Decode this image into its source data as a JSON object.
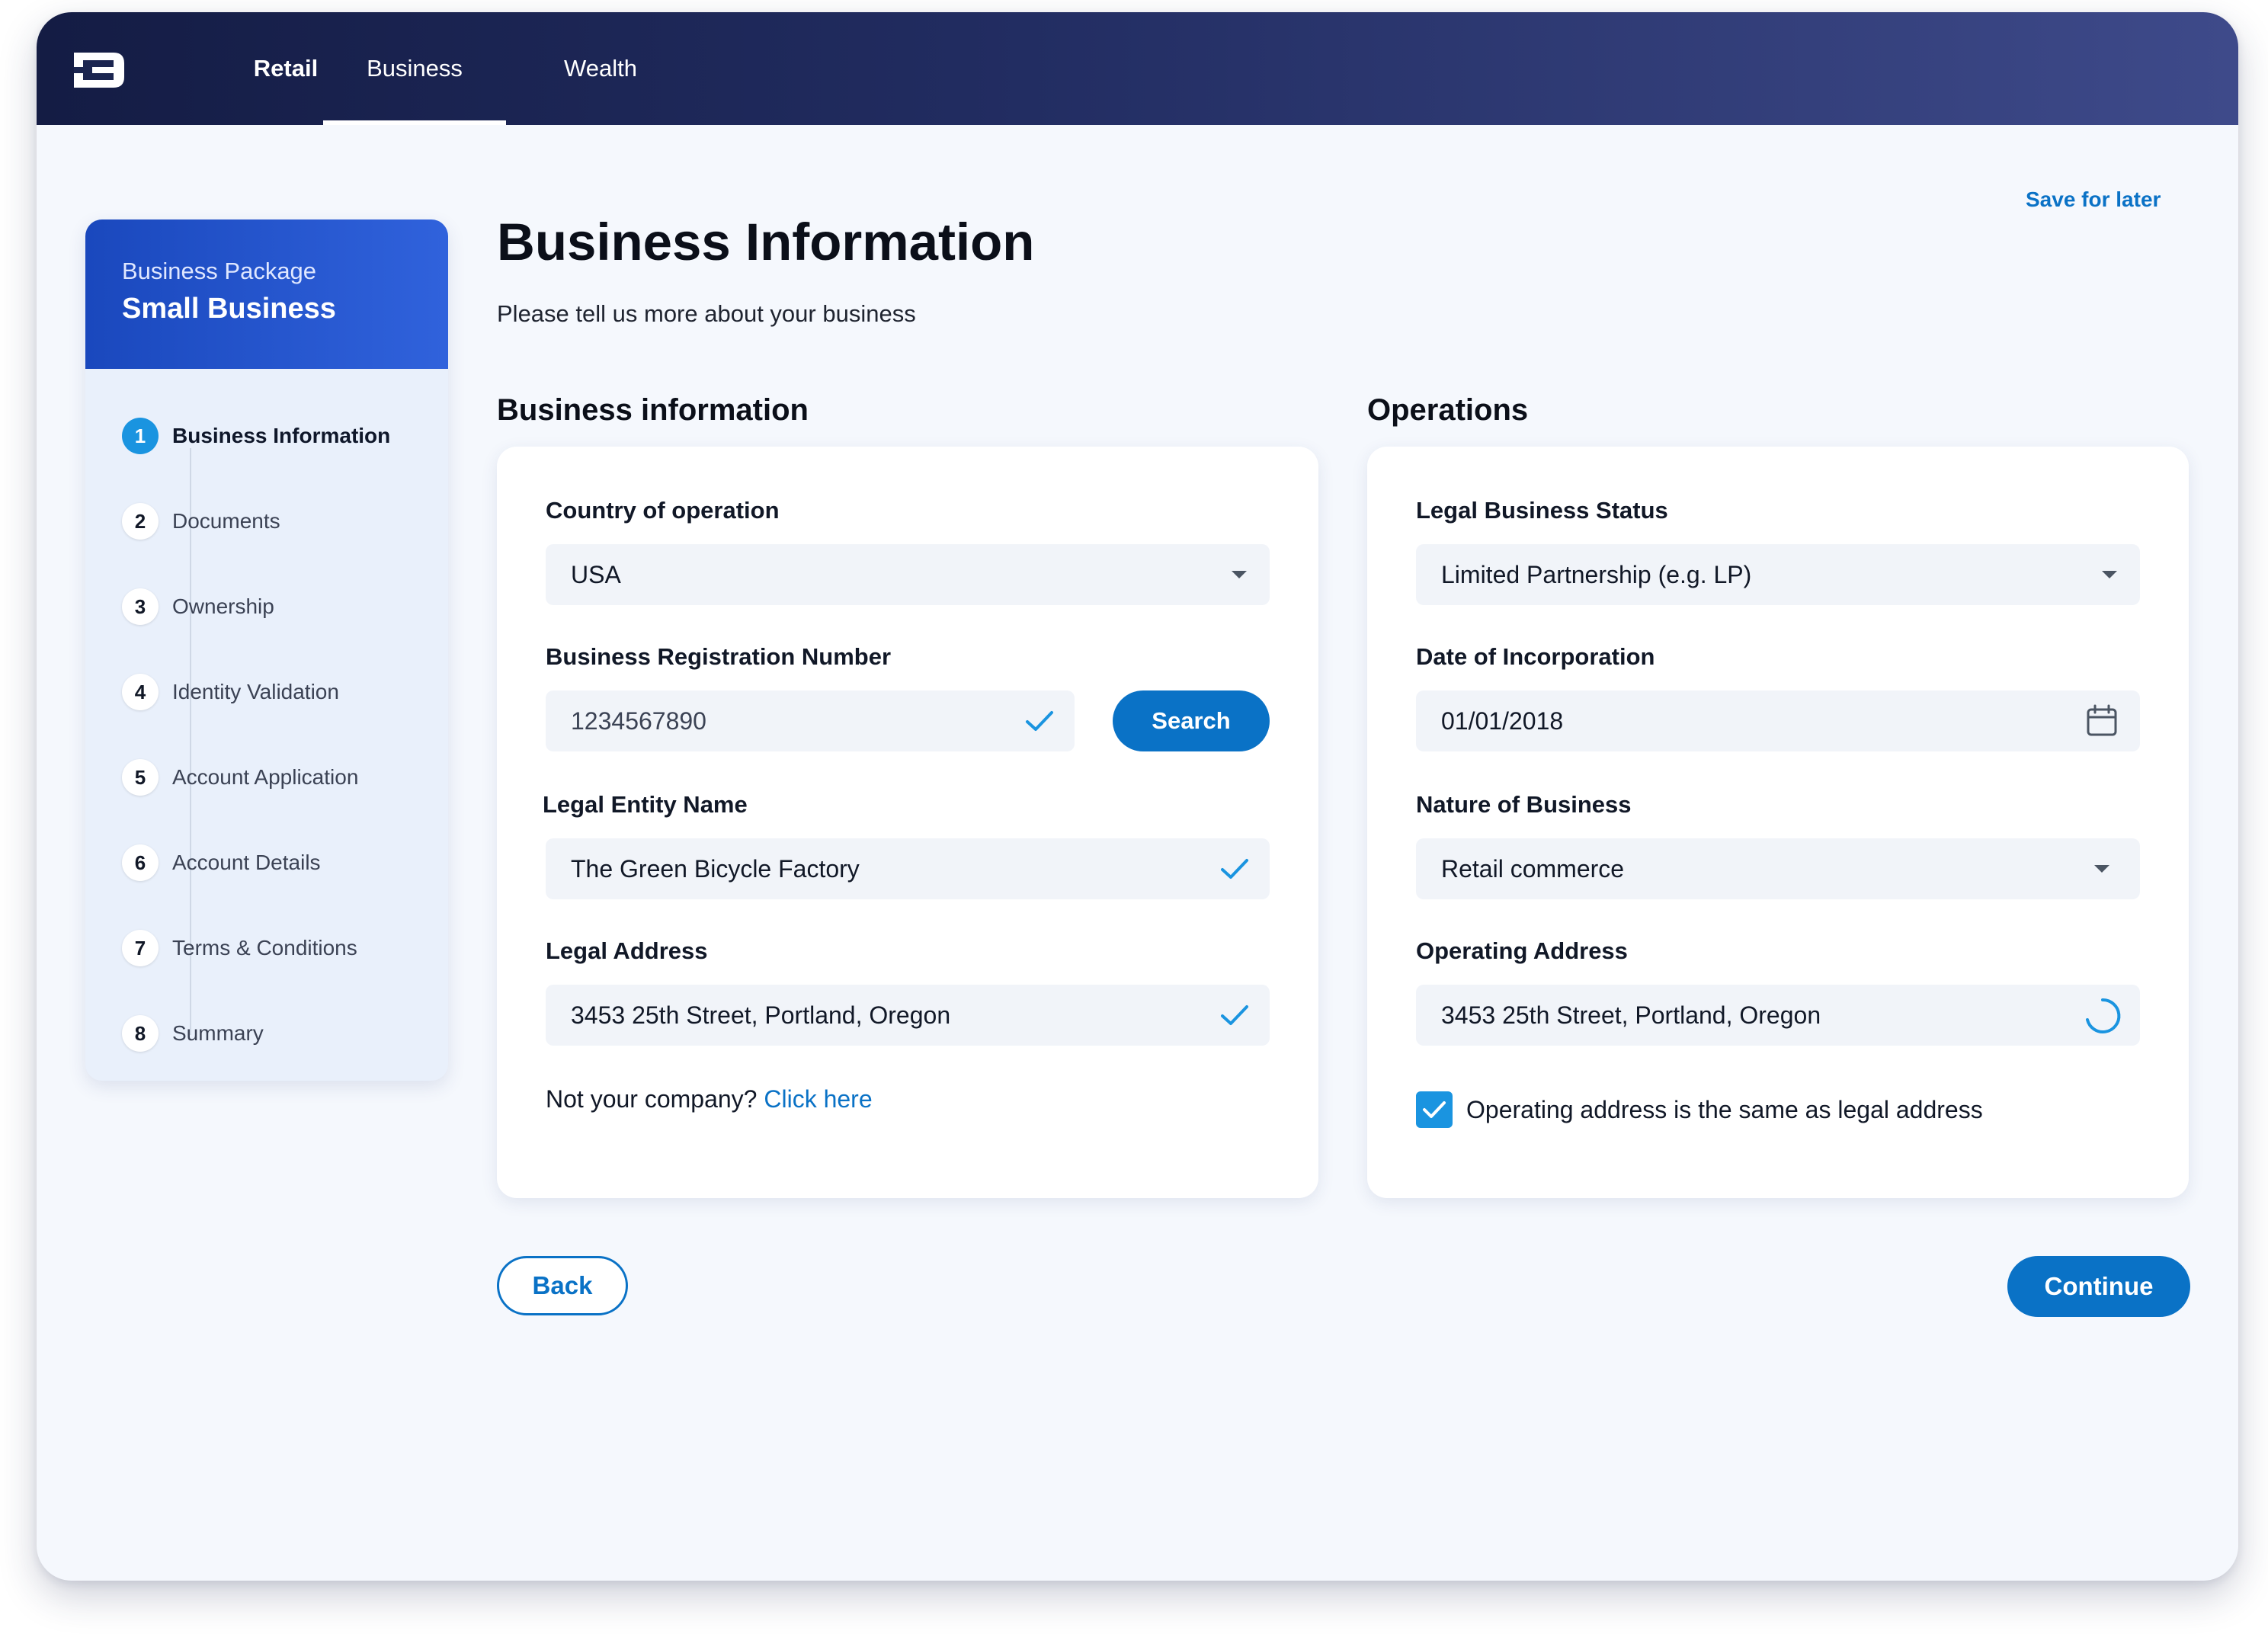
{
  "nav": {
    "tabs": [
      {
        "label": "Retail"
      },
      {
        "label": "Business"
      },
      {
        "label": "Wealth"
      }
    ]
  },
  "header": {
    "save_for_later": "Save for later"
  },
  "sidebar": {
    "package_label": "Business Package",
    "package_name": "Small Business",
    "steps": [
      {
        "num": "1",
        "label": "Business Information"
      },
      {
        "num": "2",
        "label": "Documents"
      },
      {
        "num": "3",
        "label": "Ownership"
      },
      {
        "num": "4",
        "label": "Identity Validation"
      },
      {
        "num": "5",
        "label": "Account Application"
      },
      {
        "num": "6",
        "label": "Account Details"
      },
      {
        "num": "7",
        "label": "Terms & Conditions"
      },
      {
        "num": "8",
        "label": "Summary"
      }
    ]
  },
  "main": {
    "title": "Business Information",
    "subtitle": "Please tell us more about your business"
  },
  "business_info": {
    "section_title": "Business information",
    "country_label": "Country of operation",
    "country_value": "USA",
    "reg_label": "Business Registration Number",
    "reg_value": "1234567890",
    "search_label": "Search",
    "entity_label": "Legal Entity Name",
    "entity_value": "The Green Bicycle Factory",
    "address_label": "Legal Address",
    "address_value": "3453 25th Street, Portland, Oregon",
    "not_company_text": "Not your company?",
    "click_here": "Click here"
  },
  "operations": {
    "section_title": "Operations",
    "status_label": "Legal Business Status",
    "status_value": "Limited Partnership (e.g. LP)",
    "date_label": "Date of Incorporation",
    "date_value": "01/01/2018",
    "nature_label": "Nature of Business",
    "nature_value": "Retail commerce",
    "op_address_label": "Operating Address",
    "op_address_value": "3453 25th Street, Portland, Oregon",
    "same_address_label": "Operating address is the same as legal address"
  },
  "footer": {
    "back_label": "Back",
    "continue_label": "Continue"
  },
  "colors": {
    "accent": "#0a72c6",
    "active_step": "#1a94e0",
    "nav_dark": "#141c44"
  }
}
